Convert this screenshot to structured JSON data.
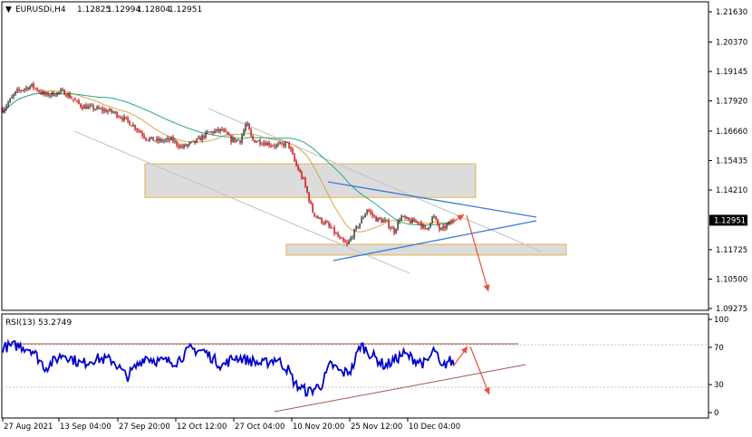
{
  "header": {
    "triangle": "▼",
    "symbol": "EURUSDi,H4",
    "open": "1.12825",
    "high": "1.12994",
    "low": "1.12804",
    "close": "1.12951"
  },
  "rsi_header": "RSI(13) 53.2749",
  "price_axis": {
    "ticks": [
      "1.21630",
      "1.20370",
      "1.19145",
      "1.17920",
      "1.16660",
      "1.15435",
      "1.14210",
      "1.12951",
      "1.11725",
      "1.10500",
      "1.09275"
    ],
    "current_price": "1.12951"
  },
  "rsi_axis": {
    "ticks": [
      "100",
      "70",
      "30",
      "0"
    ]
  },
  "time_axis": {
    "labels": [
      "27 Aug 2021",
      "13 Sep 04:00",
      "27 Sep 20:00",
      "12 Oct 12:00",
      "27 Oct 04:00",
      "10 Nov 20:00",
      "25 Nov 12:00",
      "10 Dec 04:00"
    ]
  },
  "colors": {
    "bull": "#2b2b2b",
    "bear": "#cc0000",
    "ma_fast": "#d4a84a",
    "ma_slow": "#2aa58a",
    "rsi": "#0000cc",
    "channel": "#c8c8c8",
    "triangle": "#3a7bd5",
    "arrow": "#ee4b3b",
    "zone_fill": "#dcdcdc",
    "zone_border": "#e8b24a",
    "rsi_trend": "#a05a50"
  },
  "chart_data": [
    {
      "type": "candlestick",
      "title": "EURUSDi,H4",
      "ylim": [
        1.0875,
        1.221
      ],
      "series": [
        {
          "name": "price_path",
          "x": [
            "27 Aug 2021",
            "13 Sep 04:00",
            "27 Sep 20:00",
            "12 Oct 12:00",
            "27 Oct 04:00",
            "10 Nov 20:00",
            "25 Nov 12:00",
            "10 Dec 04:00"
          ],
          "values": [
            1.1795,
            1.181,
            1.1655,
            1.1605,
            1.164,
            1.122,
            1.126,
            1.1295
          ]
        }
      ],
      "last_close": 1.12951,
      "annotations": [
        "supply zone 1.1390-1.1530",
        "demand zone 1.1150-1.1195",
        "symmetrical triangle",
        "descending channel",
        "arrow up to 1.1320",
        "arrow down to 1.1050"
      ]
    },
    {
      "type": "line",
      "title": "RSI(13) 53.2749",
      "ylim": [
        0,
        100
      ],
      "levels": [
        70,
        30
      ],
      "last_value": 53.2749
    }
  ]
}
